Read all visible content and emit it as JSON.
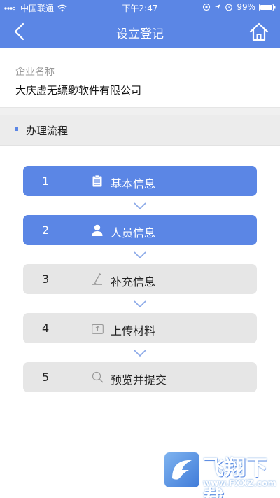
{
  "status_bar": {
    "carrier": "中国联通",
    "time": "下午2:47",
    "battery": "99%"
  },
  "nav": {
    "title": "设立登记",
    "back_icon": "chevron-left-icon",
    "home_icon": "home-icon"
  },
  "company": {
    "label": "企业名称",
    "name": "大庆虚无缥缈软件有限公司"
  },
  "process": {
    "title": "办理流程",
    "steps": [
      {
        "number": "1",
        "label": "基本信息",
        "icon": "document-icon",
        "state": "active"
      },
      {
        "number": "2",
        "label": "人员信息",
        "icon": "person-icon",
        "state": "active"
      },
      {
        "number": "3",
        "label": "补充信息",
        "icon": "pen-icon",
        "state": "inactive"
      },
      {
        "number": "4",
        "label": "上传材料",
        "icon": "upload-icon",
        "state": "inactive"
      },
      {
        "number": "5",
        "label": "预览并提交",
        "icon": "magnifier-icon",
        "state": "inactive"
      }
    ]
  },
  "watermark": {
    "text": "飞翔下载",
    "url": "www.FXXZ.com"
  },
  "colors": {
    "primary": "#5b86e5",
    "step_inactive": "#e6e6e6",
    "section_bg": "#ececec",
    "chevron": "#8aa8e8"
  }
}
